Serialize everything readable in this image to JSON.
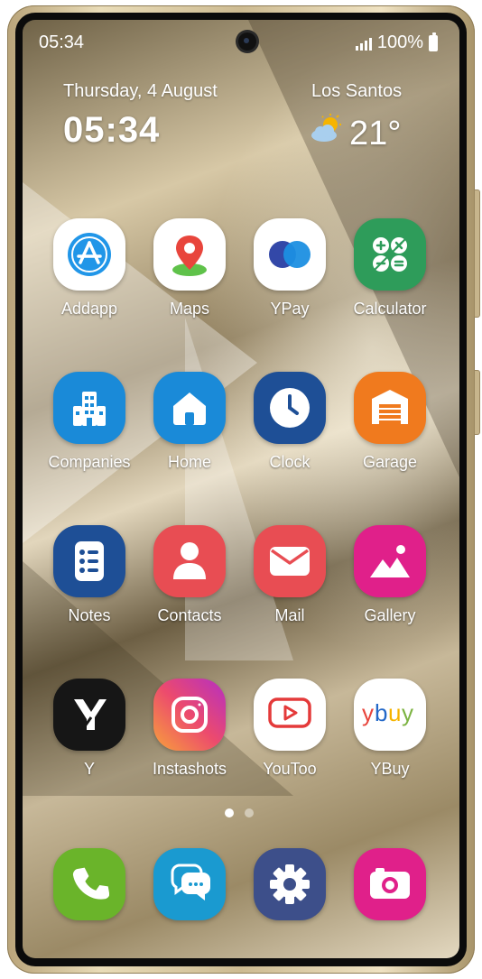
{
  "status_bar": {
    "time": "05:34",
    "battery": "100%"
  },
  "widget": {
    "date": "Thursday, 4 August",
    "time": "05:34",
    "city": "Los Santos",
    "temperature": "21°",
    "weather_icon": "partly-cloudy-icon"
  },
  "apps": [
    {
      "label": "Addapp",
      "icon": "app-store-icon"
    },
    {
      "label": "Maps",
      "icon": "map-pin-icon"
    },
    {
      "label": "YPay",
      "icon": "pay-icon"
    },
    {
      "label": "Calculator",
      "icon": "calculator-icon"
    },
    {
      "label": "Companies",
      "icon": "building-icon"
    },
    {
      "label": "Home",
      "icon": "house-icon"
    },
    {
      "label": "Clock",
      "icon": "clock-icon"
    },
    {
      "label": "Garage",
      "icon": "garage-icon"
    },
    {
      "label": "Notes",
      "icon": "notes-icon"
    },
    {
      "label": "Contacts",
      "icon": "person-icon"
    },
    {
      "label": "Mail",
      "icon": "envelope-icon"
    },
    {
      "label": "Gallery",
      "icon": "image-icon"
    },
    {
      "label": "Y",
      "icon": "y-logo-icon"
    },
    {
      "label": "Instashots",
      "icon": "instagram-icon"
    },
    {
      "label": "YouToo",
      "icon": "play-icon"
    },
    {
      "label": "YBuy",
      "icon": "ybuy-logo-icon",
      "logo_text": "ybuy"
    }
  ],
  "dock": [
    {
      "icon": "phone-icon"
    },
    {
      "icon": "messages-icon"
    },
    {
      "icon": "settings-gear-icon"
    },
    {
      "icon": "camera-icon"
    }
  ],
  "page_indicator": {
    "pages": 2,
    "current": 1
  },
  "colors": {
    "calculator": "#2e9c5a",
    "companies": "#1a8ad8",
    "home": "#1a8ad8",
    "clock": "#1e4f96",
    "garage": "#f07a1e",
    "notes": "#1e4f96",
    "contacts": "#e84d53",
    "mail": "#e84d53",
    "gallery": "#e0208a",
    "y": "#161616",
    "phone": "#6ab42a",
    "messages": "#1a9ad0",
    "settings": "#3d4f8a",
    "camera": "#e0208a"
  }
}
